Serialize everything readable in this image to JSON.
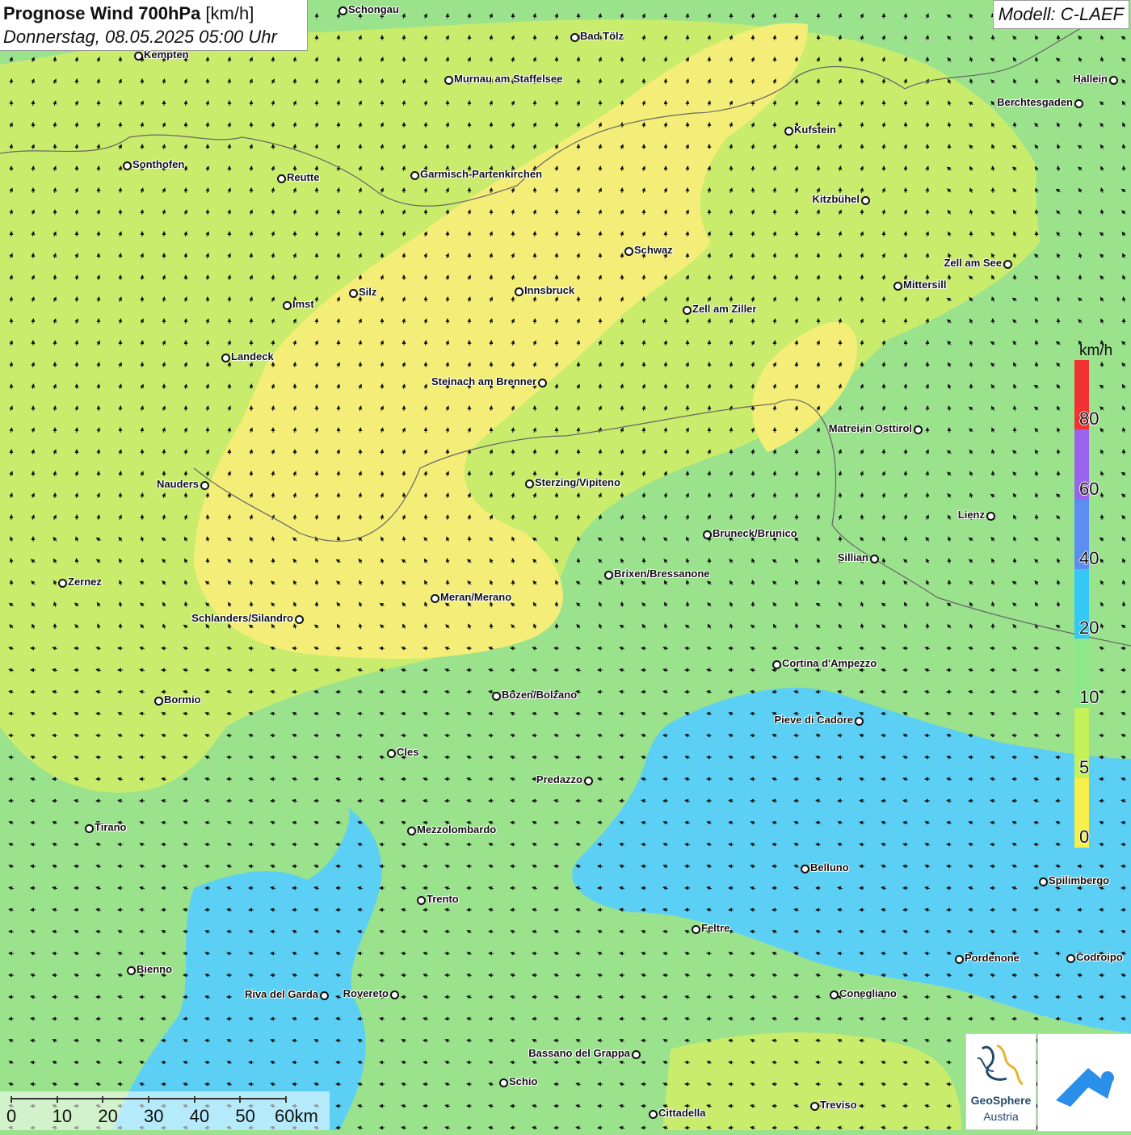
{
  "header": {
    "title_bold": "Prognose Wind 700hPa",
    "title_unit": " [km/h]",
    "subtitle": "Donnerstag, 08.05.2025 05:00 Uhr"
  },
  "model_label": "Modell: C-LAEF",
  "legend": {
    "unit": "km/h",
    "ticks": [
      "0",
      "5",
      "10",
      "20",
      "40",
      "60",
      "80"
    ],
    "colors": [
      "#f7f04a",
      "#c6f05a",
      "#8de88a",
      "#34c8f4",
      "#5b8ef0",
      "#9a63ee",
      "#f23232"
    ]
  },
  "scale_bar": {
    "labels": [
      "0",
      "10",
      "20",
      "30",
      "40",
      "50",
      "60km"
    ]
  },
  "cities": [
    {
      "name": "Schongau"
    },
    {
      "name": "Bad Tölz"
    },
    {
      "name": "Kempten"
    },
    {
      "name": "Murnau am Staffelsee"
    },
    {
      "name": "Hallein"
    },
    {
      "name": "Berchtesgaden"
    },
    {
      "name": "Kufstein"
    },
    {
      "name": "Sonthofen"
    },
    {
      "name": "Reutte"
    },
    {
      "name": "Garmisch-Partenkirchen"
    },
    {
      "name": "Kitzbühel"
    },
    {
      "name": "Schwaz"
    },
    {
      "name": "Zell am See"
    },
    {
      "name": "Silz"
    },
    {
      "name": "Innsbruck"
    },
    {
      "name": "Mittersill"
    },
    {
      "name": "Imst"
    },
    {
      "name": "Zell am Ziller"
    },
    {
      "name": "Landeck"
    },
    {
      "name": "Steinach am Brenner"
    },
    {
      "name": "Matrei in Osttirol"
    },
    {
      "name": "Nauders"
    },
    {
      "name": "Sterzing/Vipiteno"
    },
    {
      "name": "Lienz"
    },
    {
      "name": "Bruneck/Brunico"
    },
    {
      "name": "Sillian"
    },
    {
      "name": "Zernez"
    },
    {
      "name": "Brixen/Bressanone"
    },
    {
      "name": "Meran/Merano"
    },
    {
      "name": "Schlanders/Silandro"
    },
    {
      "name": "Cortina d'Ampezzo"
    },
    {
      "name": "Bormio"
    },
    {
      "name": "Bozen/Bolzano"
    },
    {
      "name": "Pieve di Cadore"
    },
    {
      "name": "Cles"
    },
    {
      "name": "Predazzo"
    },
    {
      "name": "Tirano"
    },
    {
      "name": "Mezzolombardo"
    },
    {
      "name": "Belluno"
    },
    {
      "name": "Spilimbergo"
    },
    {
      "name": "Trento"
    },
    {
      "name": "Feltre"
    },
    {
      "name": "Bienno"
    },
    {
      "name": "Pordenone"
    },
    {
      "name": "Codroipo"
    },
    {
      "name": "Riva del Garda"
    },
    {
      "name": "Rovereto"
    },
    {
      "name": "Conegliano"
    },
    {
      "name": "Bassano del Grappa"
    },
    {
      "name": "Schio"
    },
    {
      "name": "Treviso"
    },
    {
      "name": "Cittadella"
    }
  ],
  "logos": {
    "geosphere_line1": "GeoSphere",
    "geosphere_line2": "Austria"
  }
}
